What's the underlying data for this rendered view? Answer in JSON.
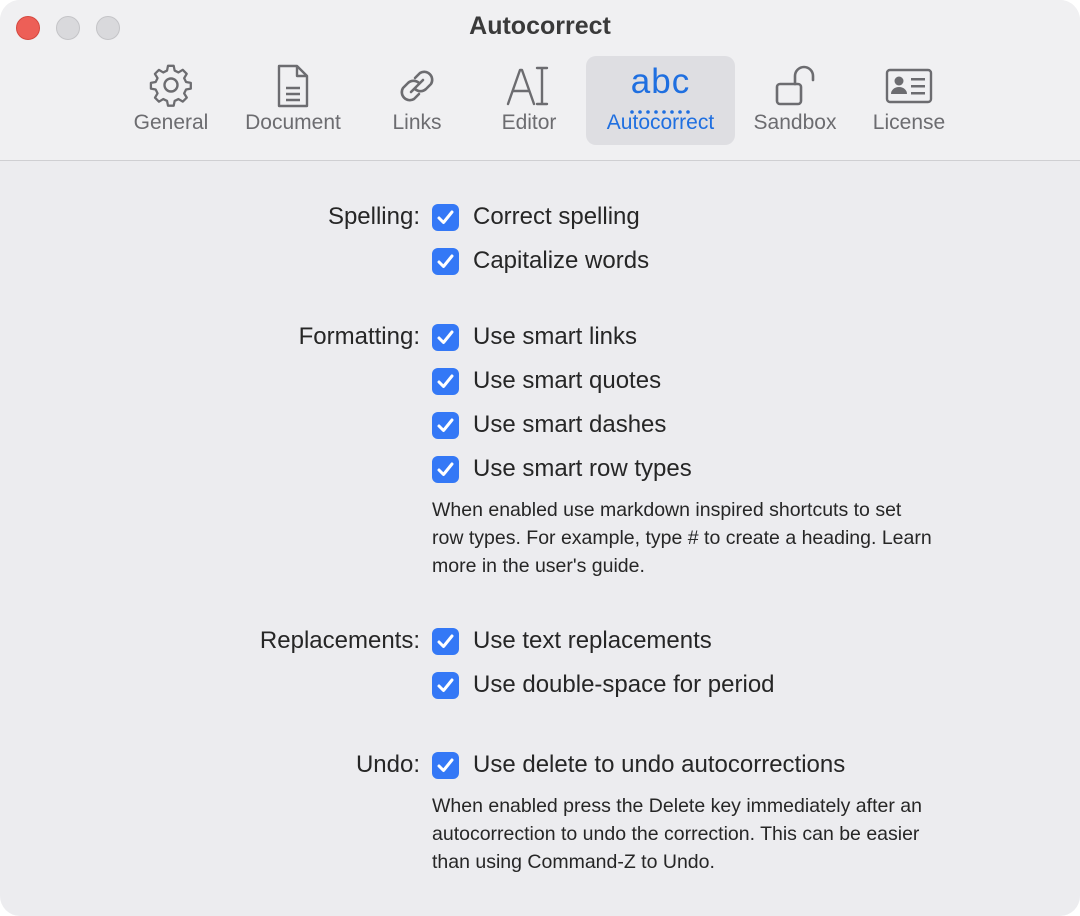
{
  "window": {
    "title": "Autocorrect"
  },
  "toolbar": {
    "tabs": [
      {
        "label": "General",
        "icon": "gear-icon"
      },
      {
        "label": "Document",
        "icon": "document-icon"
      },
      {
        "label": "Links",
        "icon": "link-icon"
      },
      {
        "label": "Editor",
        "icon": "text-cursor-icon"
      },
      {
        "label": "Autocorrect",
        "icon": "abc-icon",
        "glyph": "abc",
        "active": true
      },
      {
        "label": "Sandbox",
        "icon": "unlocked-lock-icon"
      },
      {
        "label": "License",
        "icon": "id-card-icon"
      }
    ]
  },
  "sections": {
    "spelling": {
      "label": "Spelling:",
      "options": [
        {
          "label": "Correct spelling",
          "checked": true
        },
        {
          "label": "Capitalize words",
          "checked": true
        }
      ]
    },
    "formatting": {
      "label": "Formatting:",
      "options": [
        {
          "label": "Use smart links",
          "checked": true
        },
        {
          "label": "Use smart quotes",
          "checked": true
        },
        {
          "label": "Use smart dashes",
          "checked": true
        },
        {
          "label": "Use smart row types",
          "checked": true
        }
      ],
      "description": [
        "When enabled use markdown inspired shortcuts to set",
        "row types. For example, type # to create a heading. Learn",
        "more in the user's guide."
      ]
    },
    "replacements": {
      "label": "Replacements:",
      "options": [
        {
          "label": "Use text replacements",
          "checked": true
        },
        {
          "label": "Use double-space for period",
          "checked": true
        }
      ]
    },
    "undo": {
      "label": "Undo:",
      "options": [
        {
          "label": "Use delete to undo autocorrections",
          "checked": true
        }
      ],
      "description": [
        "When enabled press the Delete key immediately after an",
        "autocorrection to undo the correction. This can be easier",
        "than using Command-Z to Undo."
      ]
    }
  },
  "colors": {
    "accent": "#3478f6",
    "active_tab_text": "#1f6fe0",
    "close": "#ed5f57"
  }
}
